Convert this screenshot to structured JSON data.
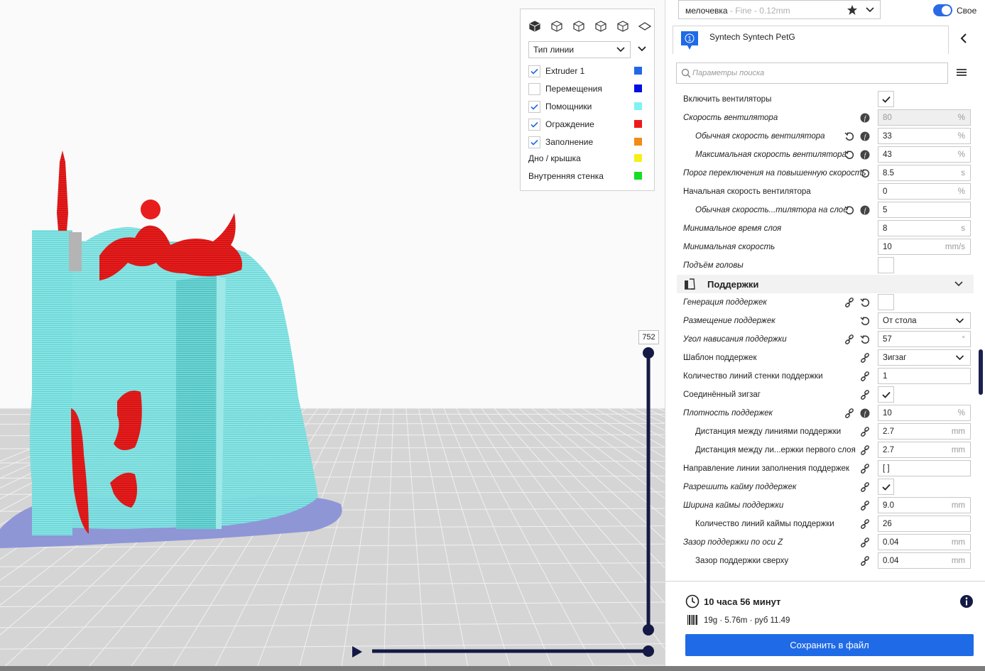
{
  "viewport": {
    "layer_number": "752",
    "colors": {
      "build_plate": "#c8c8c8",
      "support": "#7ee3e3",
      "wall": "#e81d1d",
      "brim": "#8b8fd0",
      "slider": "#141a45"
    }
  },
  "legend": {
    "view_buttons": [
      "3d-view-icon",
      "front-view-icon",
      "top-view-icon",
      "left-view-icon",
      "right-view-icon",
      "layer-view-icon"
    ],
    "line_type_label": "Тип линии",
    "items": [
      {
        "label": "Extruder 1",
        "checked": true,
        "color": "#2168e8"
      },
      {
        "label": "Перемещения",
        "checked": false,
        "color": "#0010e0"
      },
      {
        "label": "Помощники",
        "checked": true,
        "color": "#7ff3f3"
      },
      {
        "label": "Ограждение",
        "checked": true,
        "color": "#ee1a1a"
      },
      {
        "label": "Заполнение",
        "checked": true,
        "color": "#f38b17"
      },
      {
        "label": "Дно / крышка",
        "checked": null,
        "color": "#f5ef1c"
      },
      {
        "label": "Внутренняя стенка",
        "checked": null,
        "color": "#17dd23"
      }
    ]
  },
  "panel": {
    "profile_name": "мелочевка",
    "profile_detail": "- Fine - 0.12mm",
    "custom_label": "Свое",
    "extruder_number": "1",
    "material_name": "Syntech Syntech PetG",
    "search_placeholder": "Параметры поиска",
    "section_support_title": "Поддержки",
    "settings": [
      {
        "label": "Включить вентиляторы",
        "italic": false,
        "indent": false,
        "type": "checkbox",
        "checked": true,
        "reset": false,
        "link": false,
        "fx": false
      },
      {
        "label": "Скорость вентилятора",
        "italic": true,
        "indent": false,
        "type": "field",
        "value": "80",
        "unit": "%",
        "disabled": true,
        "reset": false,
        "link": false,
        "fx": true
      },
      {
        "label": "Обычная скорость вентилятора",
        "italic": true,
        "indent": true,
        "type": "field",
        "value": "33",
        "unit": "%",
        "reset": true,
        "link": false,
        "fx": true
      },
      {
        "label": "Максимальная скорость вентилятора",
        "italic": true,
        "indent": true,
        "type": "field",
        "value": "43",
        "unit": "%",
        "reset": true,
        "link": false,
        "fx": true
      },
      {
        "label": "Порог переключения на повышенную скорость",
        "italic": true,
        "indent": false,
        "type": "field",
        "value": "8.5",
        "unit": "s",
        "reset": true,
        "link": false,
        "fx": false
      },
      {
        "label": "Начальная скорость вентилятора",
        "italic": false,
        "indent": false,
        "type": "field",
        "value": "0",
        "unit": "%",
        "reset": false,
        "link": false,
        "fx": false
      },
      {
        "label": "Обычная скорость...тилятора на слое",
        "italic": true,
        "indent": true,
        "type": "field",
        "value": "5",
        "unit": "",
        "reset": true,
        "link": false,
        "fx": true
      },
      {
        "label": "Минимальное время слоя",
        "italic": true,
        "indent": false,
        "type": "field",
        "value": "8",
        "unit": "s",
        "reset": false,
        "link": false,
        "fx": false
      },
      {
        "label": "Минимальная скорость",
        "italic": true,
        "indent": false,
        "type": "field",
        "value": "10",
        "unit": "mm/s",
        "reset": false,
        "link": false,
        "fx": false
      },
      {
        "label": "Подъём головы",
        "italic": true,
        "indent": false,
        "type": "checkbox",
        "checked": false,
        "reset": false,
        "link": false,
        "fx": false
      }
    ],
    "support_settings": [
      {
        "label": "Генерация поддержек",
        "italic": true,
        "indent": false,
        "type": "checkbox",
        "checked": false,
        "reset": true,
        "link": true,
        "fx": false
      },
      {
        "label": "Размещение поддержек",
        "italic": true,
        "indent": false,
        "type": "select",
        "value": "От стола",
        "reset": true,
        "link": false,
        "fx": false
      },
      {
        "label": "Угол нависания поддержки",
        "italic": true,
        "indent": false,
        "type": "field",
        "value": "57",
        "unit": "°",
        "reset": true,
        "link": true,
        "fx": false
      },
      {
        "label": "Шаблон поддержек",
        "italic": false,
        "indent": false,
        "type": "select",
        "value": "Зигзаг",
        "reset": false,
        "link": true,
        "fx": false
      },
      {
        "label": "Количество линий стенки поддержки",
        "italic": false,
        "indent": false,
        "type": "field",
        "value": "1",
        "unit": "",
        "reset": false,
        "link": true,
        "fx": false
      },
      {
        "label": "Соединённый зигзаг",
        "italic": false,
        "indent": false,
        "type": "checkbox",
        "checked": true,
        "reset": false,
        "link": true,
        "fx": false
      },
      {
        "label": "Плотность поддержек",
        "italic": true,
        "indent": false,
        "type": "field",
        "value": "10",
        "unit": "%",
        "reset": false,
        "link": true,
        "fx": true
      },
      {
        "label": "Дистанция между линиями поддержки",
        "italic": false,
        "indent": true,
        "type": "field",
        "value": "2.7",
        "unit": "mm",
        "reset": false,
        "link": true,
        "fx": false
      },
      {
        "label": "Дистанция между ли...ержки первого слоя",
        "italic": false,
        "indent": true,
        "type": "field",
        "value": "2.7",
        "unit": "mm",
        "reset": false,
        "link": true,
        "fx": false
      },
      {
        "label": "Направление линии заполнения поддержек",
        "italic": false,
        "indent": false,
        "type": "field",
        "value": "[ ]",
        "unit": "",
        "reset": false,
        "link": true,
        "fx": false
      },
      {
        "label": "Разрешить кайму поддержек",
        "italic": true,
        "indent": false,
        "type": "checkbox",
        "checked": true,
        "reset": false,
        "link": true,
        "fx": false
      },
      {
        "label": "Ширина каймы поддержки",
        "italic": true,
        "indent": false,
        "type": "field",
        "value": "9.0",
        "unit": "mm",
        "reset": false,
        "link": true,
        "fx": false
      },
      {
        "label": "Количество линий каймы поддержки",
        "italic": false,
        "indent": true,
        "type": "field",
        "value": "26",
        "unit": "",
        "reset": false,
        "link": true,
        "fx": false
      },
      {
        "label": "Зазор поддержки по оси Z",
        "italic": true,
        "indent": false,
        "type": "field",
        "value": "0.04",
        "unit": "mm",
        "reset": false,
        "link": true,
        "fx": false
      },
      {
        "label": "Зазор поддержки сверху",
        "italic": false,
        "indent": true,
        "type": "field",
        "value": "0.04",
        "unit": "mm",
        "reset": false,
        "link": true,
        "fx": false
      }
    ],
    "print_time": "10 часа 56 минут",
    "print_stats": "19g · 5.76m · руб 11.49",
    "save_label": "Сохранить в файл",
    "accent": "#1f6ae6"
  }
}
